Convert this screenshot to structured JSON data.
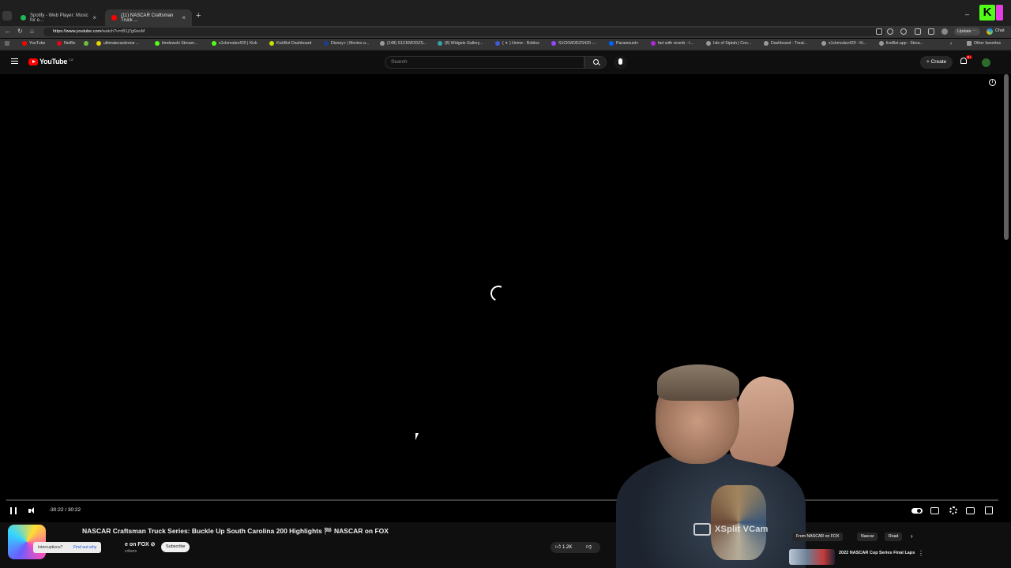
{
  "browser": {
    "tabs": [
      {
        "title": "Spotify - Web Player: Music for e...",
        "active": false,
        "favicon_color": "#1db954"
      },
      {
        "title": "(11) NASCAR Craftsman Truck ...",
        "active": true,
        "favicon_color": "#ff0000"
      }
    ],
    "new_tab_label": "+",
    "close_label": "×",
    "url_host": "https://www.youtube.com",
    "url_path": "/watch?v=rB1j7g6wvM",
    "update_label": "Update ⋯",
    "chat_label": "Chat",
    "minimize_label": "–"
  },
  "bookmarks": [
    {
      "label": "YouTube",
      "color": "#ff0000"
    },
    {
      "label": "Netflix",
      "color": "#e50914"
    },
    {
      "label": "ultimatecardzone ...",
      "color": "#e5d300"
    },
    {
      "label": "timdewski Stream...",
      "color": "#53fc18"
    },
    {
      "label": "s1ckmodzz420 | Kick",
      "color": "#53fc18"
    },
    {
      "label": "KickBot Dashboard",
      "color": "#c8e000"
    },
    {
      "label": "Disney+ | Movies a...",
      "color": "#1d3c8f"
    },
    {
      "label": "(148) S1CKMODZS...",
      "color": "#9a9a9a"
    },
    {
      "label": "(8) Widgets Gallery...",
      "color": "#3aa0a8"
    },
    {
      "label": "( ✦ ) Home - Roblox",
      "color": "#3d5ad7"
    },
    {
      "label": "S1CKMODZS420 -...",
      "color": "#9146ff"
    },
    {
      "label": "Paramount+",
      "color": "#0064ff"
    },
    {
      "label": "fart with reverb - I...",
      "color": "#b02ad8"
    },
    {
      "label": "Isle of Siptah | Con...",
      "color": "#9a9a9a"
    },
    {
      "label": "Dashboard - Treat...",
      "color": "#9a9a9a"
    },
    {
      "label": "s1ckmodzz420 - Ki...",
      "color": "#9a9a9a"
    },
    {
      "label": "liveBot.app - Strea...",
      "color": "#9a9a9a"
    },
    {
      "label": "Other favorites",
      "color": "#9a9a9a"
    }
  ],
  "youtube": {
    "logo_text": "YouTube",
    "country_code": "CA",
    "search_placeholder": "Search",
    "create_label": "Create",
    "notif_badge": "9+"
  },
  "player": {
    "state": "buffering",
    "time_display": "-30:22 / 30:22",
    "progress": 0.0
  },
  "video": {
    "title": "NASCAR Craftsman Truck Series: Buckle Up South Carolina 200 Highlights 🏁 NASCAR on FOX",
    "channel_name": "e on FOX ⊘",
    "subs_text": "cribers",
    "subscribe_label": "Subscribe",
    "like_count": "1.2K"
  },
  "toast": {
    "message": "interruptions?",
    "link": "Find out why"
  },
  "chips": [
    {
      "label": "From NASCAR on FOX",
      "selected": false
    },
    {
      "label": "Nascar",
      "selected": false
    },
    {
      "label": "Road",
      "selected": false
    }
  ],
  "chips_next": "›",
  "recommendation": {
    "title": "2022 NASCAR Cup Series Final Laps",
    "menu": "⋮"
  },
  "overlay": {
    "webcam_label": "XSplit VCam"
  }
}
